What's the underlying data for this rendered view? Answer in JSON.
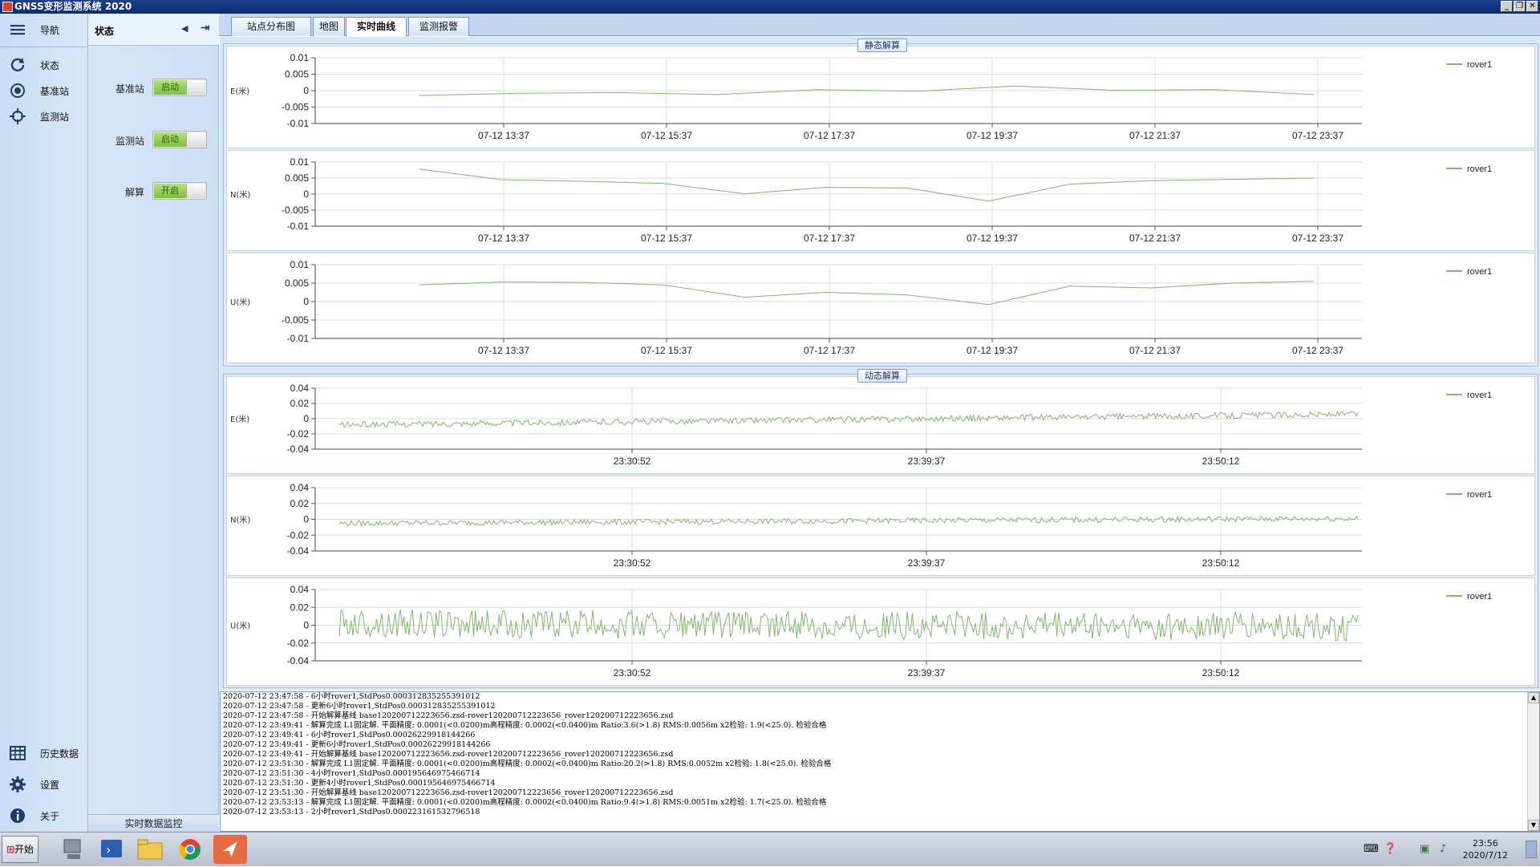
{
  "window": {
    "title": "GNSS变形监测系统 2020"
  },
  "nav": {
    "header": "导航",
    "items": [
      {
        "label": "状态",
        "icon": "refresh-icon"
      },
      {
        "label": "基准站",
        "icon": "target-icon"
      },
      {
        "label": "监测站",
        "icon": "crosshair-icon"
      }
    ],
    "bottom_items": [
      {
        "label": "历史数据",
        "icon": "table-icon"
      },
      {
        "label": "设置",
        "icon": "gear-icon"
      },
      {
        "label": "关于",
        "icon": "info-icon"
      }
    ]
  },
  "status_panel": {
    "title": "状态",
    "rows": [
      {
        "label": "基准站",
        "toggle": "启动"
      },
      {
        "label": "监测站",
        "toggle": "启动"
      },
      {
        "label": "解算",
        "toggle": "开启"
      }
    ],
    "footer": "实时数据监控"
  },
  "tabs": [
    "站点分布图",
    "地图",
    "实时曲线",
    "监测报警"
  ],
  "active_tab": 2,
  "static_section": {
    "title": "静态解算",
    "charts": [
      {
        "ylabel": "E(米)",
        "legend": "rover1"
      },
      {
        "ylabel": "N(米)",
        "legend": "rover1"
      },
      {
        "ylabel": "U(米)",
        "legend": "rover1"
      }
    ]
  },
  "dynamic_section": {
    "title": "动态解算",
    "charts": [
      {
        "ylabel": "E(米)",
        "legend": "rover1"
      },
      {
        "ylabel": "N(米)",
        "legend": "rover1"
      },
      {
        "ylabel": "U(米)",
        "legend": "rover1"
      }
    ]
  },
  "chart_data": [
    {
      "type": "line",
      "ylabel": "E(米)",
      "ylim": [
        -0.01,
        0.01
      ],
      "yticks": [
        "0.01",
        "0.005",
        "0",
        "-0.005",
        "-0.01"
      ],
      "xticks": [
        "07-12 13:37",
        "07-12 15:37",
        "07-12 17:37",
        "07-12 19:37",
        "07-12 21:37",
        "07-12 23:37"
      ],
      "series": [
        {
          "name": "rover1",
          "color": "#7fb86a",
          "values": [
            -0.0015,
            -0.0008,
            -0.0006,
            -0.0012,
            0.0003,
            -0.0002,
            0.0014,
            0.0001,
            0.0003,
            -0.0012
          ]
        }
      ]
    },
    {
      "type": "line",
      "ylabel": "N(米)",
      "ylim": [
        -0.01,
        0.01
      ],
      "yticks": [
        "0.01",
        "0.005",
        "0",
        "-0.005",
        "-0.01"
      ],
      "xticks": [
        "07-12 13:37",
        "07-12 15:37",
        "07-12 17:37",
        "07-12 19:37",
        "07-12 21:37",
        "07-12 23:37"
      ],
      "series": [
        {
          "name": "rover1",
          "color": "#7fb86a",
          "values": [
            0.0078,
            0.0045,
            0.004,
            0.0033,
            0.0001,
            0.0021,
            0.0019,
            -0.0022,
            0.0031,
            0.0042,
            0.0046,
            0.005
          ]
        }
      ]
    },
    {
      "type": "line",
      "ylabel": "U(米)",
      "ylim": [
        -0.01,
        0.01
      ],
      "yticks": [
        "0.01",
        "0.005",
        "0",
        "-0.005",
        "-0.01"
      ],
      "xticks": [
        "07-12 13:37",
        "07-12 15:37",
        "07-12 17:37",
        "07-12 19:37",
        "07-12 21:37",
        "07-12 23:37"
      ],
      "series": [
        {
          "name": "rover1",
          "color": "#7fb86a",
          "values": [
            0.0045,
            0.0053,
            0.0052,
            0.0045,
            0.0012,
            0.0025,
            0.0018,
            -0.0008,
            0.0042,
            0.0037,
            0.005,
            0.0055
          ]
        }
      ]
    },
    {
      "type": "line",
      "ylabel": "E(米)",
      "ylim": [
        -0.04,
        0.04
      ],
      "yticks": [
        "0.04",
        "0.02",
        "0",
        "-0.02",
        "-0.04"
      ],
      "xticks": [
        "23:30:52",
        "23:39:37",
        "23:50:12"
      ],
      "series": [
        {
          "name": "rover1",
          "color": "#7fb86a",
          "trend": [
            -0.008,
            0.006
          ],
          "noise": 0.004,
          "samples": 600
        }
      ]
    },
    {
      "type": "line",
      "ylabel": "N(米)",
      "ylim": [
        -0.04,
        0.04
      ],
      "yticks": [
        "0.04",
        "0.02",
        "0",
        "-0.02",
        "-0.04"
      ],
      "xticks": [
        "23:30:52",
        "23:39:37",
        "23:50:12"
      ],
      "series": [
        {
          "name": "rover1",
          "color": "#7fb86a",
          "trend": [
            -0.005,
            0.001
          ],
          "noise": 0.0035,
          "samples": 600
        }
      ]
    },
    {
      "type": "line",
      "ylabel": "U(米)",
      "ylim": [
        -0.04,
        0.04
      ],
      "yticks": [
        "0.04",
        "0.02",
        "0",
        "-0.02",
        "-0.04"
      ],
      "xticks": [
        "23:30:52",
        "23:39:37",
        "23:50:12"
      ],
      "series": [
        {
          "name": "rover1",
          "color": "#7fb86a",
          "trend": [
            0.002,
            -0.002
          ],
          "noise": 0.016,
          "samples": 600
        }
      ]
    }
  ],
  "log": [
    "2020-07-12 23:47:58 - 6小时rover1,StdPos0.000312835255391012",
    "2020-07-12 23:47:58 - 更新6小时rover1,StdPos0.000312835255391012",
    "2020-07-12 23:47:58 - 开始解算基线 base120200712223656.zsd-rover120200712223656_rover120200712223656.zsd",
    "2020-07-12 23:49:41 - 解算完成 L1固定解. 平面精度: 0.0001(<0.0200)m高程精度: 0.0002(<0.0400)m Ratio:3.6(>1.8) RMS:0.0056m x2检验: 1.9(<25.0). 检验合格",
    "2020-07-12 23:49:41 - 6小时rover1,StdPos0.00026229918144266",
    "2020-07-12 23:49:41 - 更新6小时rover1,StdPos0.00026229918144266",
    "2020-07-12 23:49:41 - 开始解算基线 base120200712223656.zsd-rover120200712223656_rover120200712223656.zsd",
    "2020-07-12 23:51:30 - 解算完成 L1固定解. 平面精度: 0.0001(<0.0200)m高程精度: 0.0002(<0.0400)m Ratio:20.2(>1.8) RMS:0.0052m x2检验: 1.8(<25.0). 检验合格",
    "2020-07-12 23:51:30 - 4小时rover1,StdPos0.000195646975466714",
    "2020-07-12 23:51:30 - 更新4小时rover1,StdPos0.000195646975466714",
    "2020-07-12 23:51:30 - 开始解算基线 base120200712223656.zsd-rover120200712223656_rover120200712223656.zsd",
    "2020-07-12 23:53:13 - 解算完成 L1固定解. 平面精度: 0.0001(<0.0200)m高程精度: 0.0002(<0.0400)m Ratio:9.4(>1.8) RMS:0.0051m x2检验: 1.7(<25.0). 检验合格",
    "2020-07-12 23:53:13 - 2小时rover1,StdPos0.000223161532796518"
  ],
  "taskbar": {
    "start_label": "开始",
    "clock_time": "23:56",
    "clock_date": "2020/7/12"
  }
}
